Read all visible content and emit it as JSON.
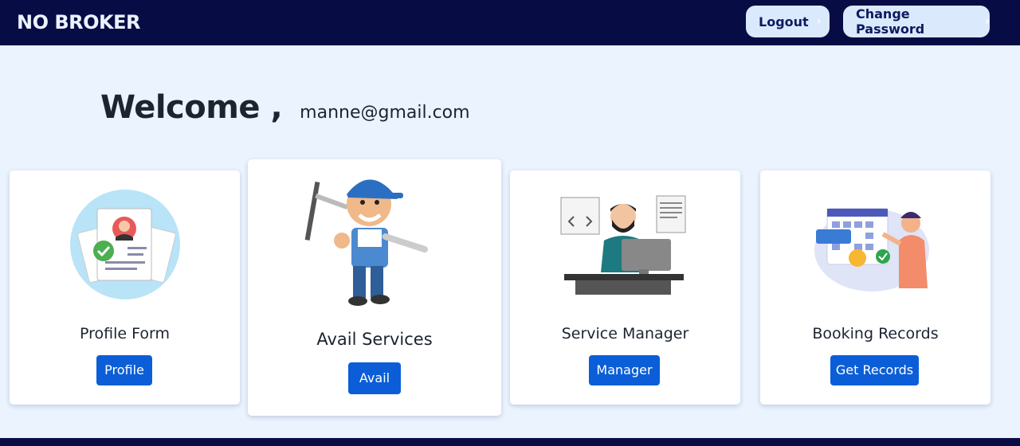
{
  "navbar": {
    "brand": "NO BROKER",
    "logout_label": "Logout",
    "change_password_label": "Change Password"
  },
  "welcome": {
    "heading": "Welcome ,",
    "email": "manne@gmail.com"
  },
  "cards": [
    {
      "title": "Profile Form",
      "button": "Profile",
      "illustration": "profile-form-illustration"
    },
    {
      "title": "Avail Services",
      "button": "Avail",
      "illustration": "cleaner-worker-illustration"
    },
    {
      "title": "Service Manager",
      "button": "Manager",
      "illustration": "manager-at-desk-illustration"
    },
    {
      "title": "Booking Records",
      "button": "Get Records",
      "illustration": "calendar-booking-illustration"
    }
  ],
  "colors": {
    "navbar_bg": "#080c45",
    "page_bg": "#eaf3fe",
    "button_blue": "#0b5ed7",
    "nav_button_bg": "#dbe9fd"
  }
}
